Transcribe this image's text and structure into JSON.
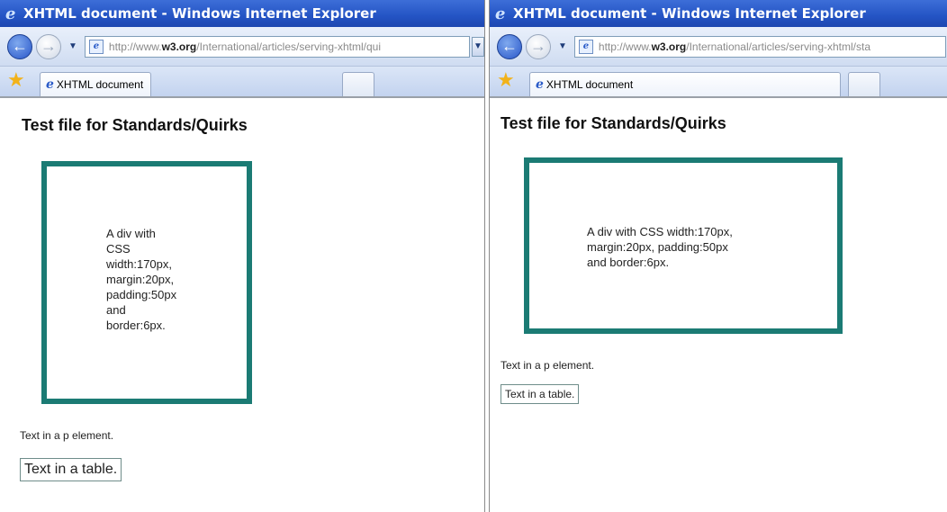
{
  "windows": [
    {
      "title": "XHTML document - Windows Internet Explorer",
      "address": {
        "prefix": "http://www.",
        "domain": "w3.org",
        "path": "/International/articles/serving-xhtml/qui"
      },
      "tab_label": "XHTML document",
      "page": {
        "heading": "Test file for Standards/Quirks",
        "box_text_lines": [
          "A div with",
          "CSS",
          "width:170px,",
          "margin:20px,",
          "padding:50px",
          "and",
          "border:6px."
        ],
        "p_text": "Text in a p element.",
        "table_text": "Text in a table."
      }
    },
    {
      "title": "XHTML document - Windows Internet Explorer",
      "address": {
        "prefix": "http://www.",
        "domain": "w3.org",
        "path": "/International/articles/serving-xhtml/sta"
      },
      "tab_label": "XHTML document",
      "page": {
        "heading": "Test file for Standards/Quirks",
        "box_text_lines": [
          "A div with CSS width:170px,",
          "margin:20px, padding:50px",
          "and border:6px."
        ],
        "p_text": "Text in a p element.",
        "table_text": "Text in a table."
      }
    }
  ],
  "icons": {
    "ie_logo": "ie-logo-icon",
    "back": "back-arrow-icon",
    "forward": "forward-arrow-icon",
    "favorites": "star-icon",
    "page": "page-icon"
  },
  "colors": {
    "box_border": "#1b7b74",
    "titlebar": "#2454c4"
  }
}
